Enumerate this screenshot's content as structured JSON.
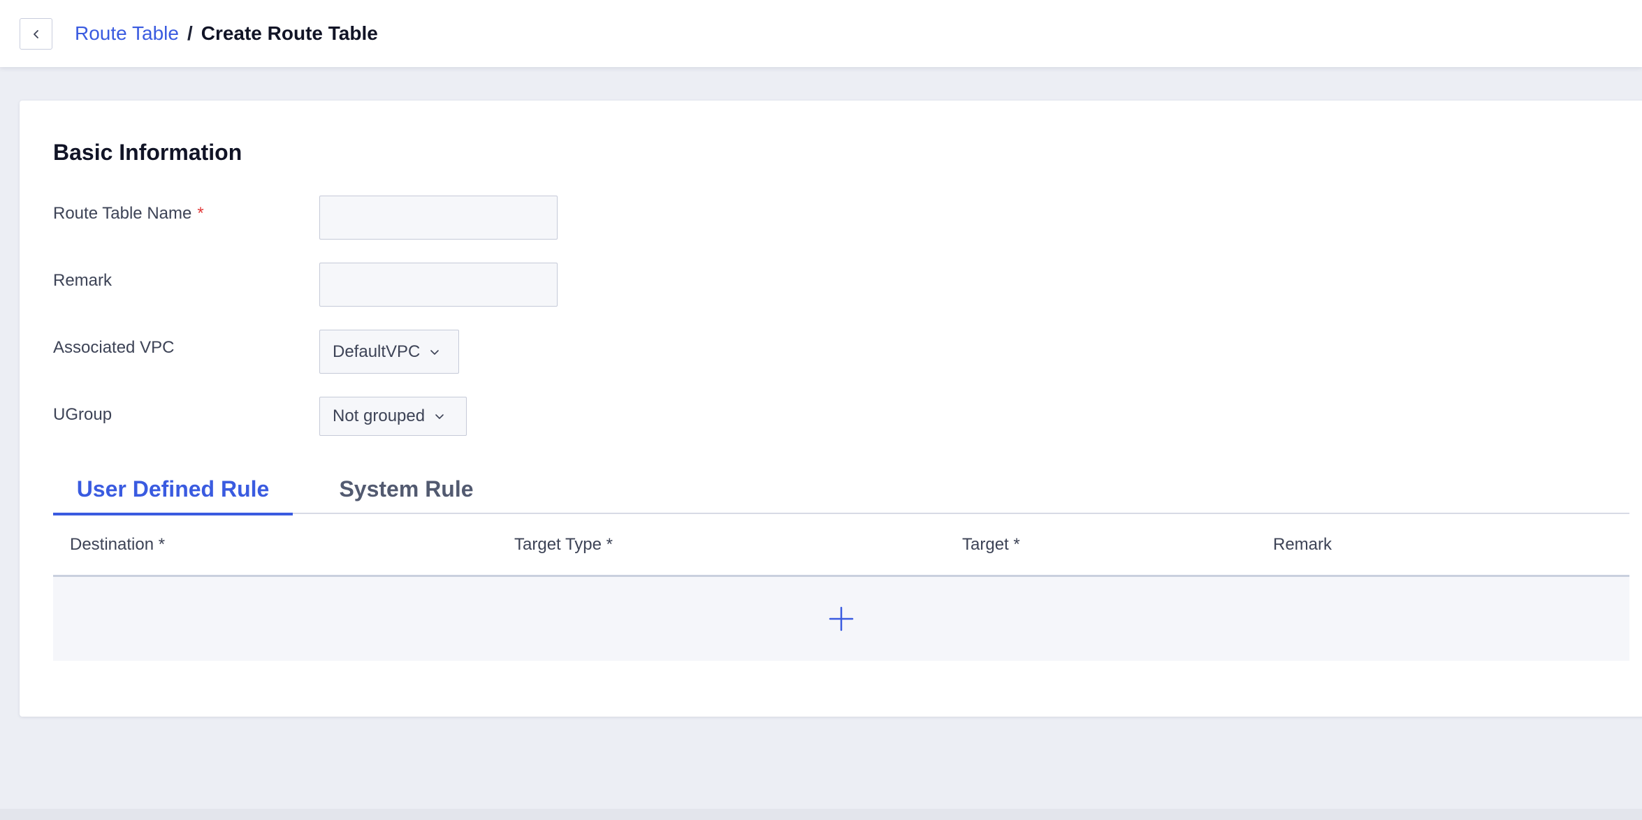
{
  "header": {
    "back_icon": "chevron-left-icon",
    "breadcrumb_parent": "Route Table",
    "breadcrumb_separator": "/",
    "breadcrumb_current": "Create Route Table"
  },
  "basic_info": {
    "title": "Basic Information",
    "fields": {
      "route_table_name": {
        "label": "Route Table Name",
        "required_mark": "*",
        "value": "",
        "placeholder": ""
      },
      "remark": {
        "label": "Remark",
        "value": "",
        "placeholder": ""
      },
      "associated_vpc": {
        "label": "Associated VPC",
        "selected": "DefaultVPC"
      },
      "ugroup": {
        "label": "UGroup",
        "selected": "Not grouped"
      }
    }
  },
  "tabs": [
    {
      "label": "User Defined Rule",
      "active": true
    },
    {
      "label": "System Rule",
      "active": false
    }
  ],
  "rules_table": {
    "columns": [
      "Destination *",
      "Target Type *",
      "Target *",
      "Remark"
    ],
    "add_icon": "plus-icon"
  },
  "colors": {
    "accent": "#3a5be0",
    "required": "#e23b3b",
    "background": "#eceef4"
  }
}
